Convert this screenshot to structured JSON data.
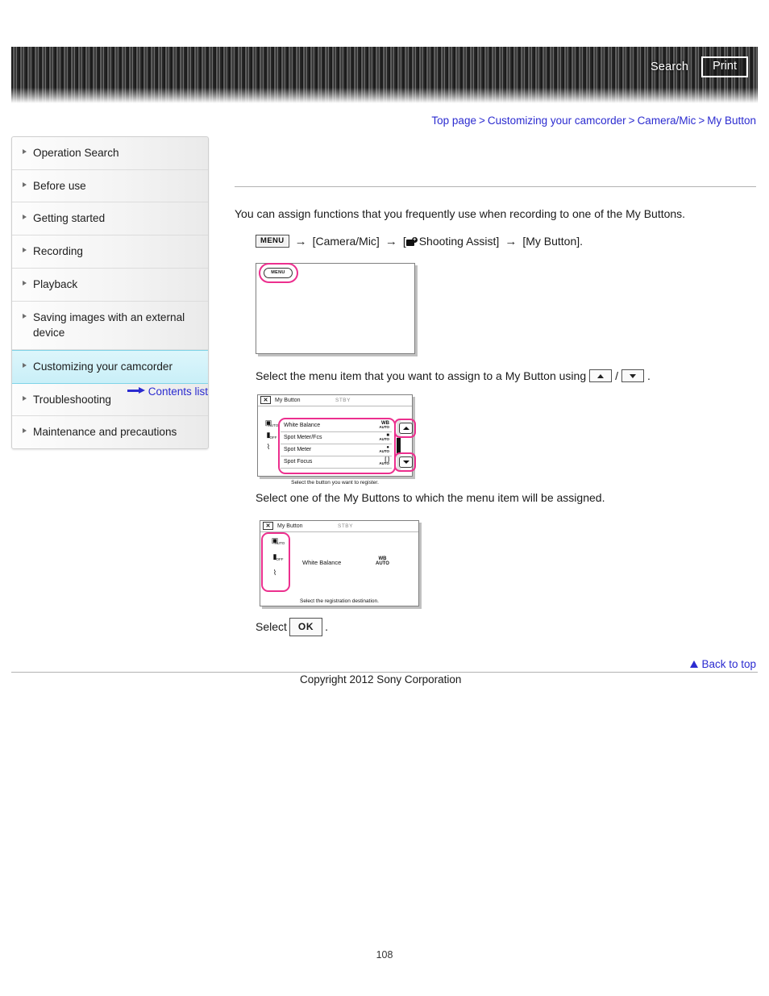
{
  "header": {
    "search_label": "Search",
    "print_label": "Print"
  },
  "breadcrumb": {
    "items": [
      {
        "label": "Top page"
      },
      {
        "label": "Customizing your camcorder"
      },
      {
        "label": "Camera/Mic"
      },
      {
        "label": "My Button"
      }
    ],
    "separator": ">"
  },
  "sidebar": {
    "items": [
      {
        "label": "Operation Search",
        "active": false
      },
      {
        "label": "Before use",
        "active": false
      },
      {
        "label": "Getting started",
        "active": false
      },
      {
        "label": "Recording",
        "active": false
      },
      {
        "label": "Playback",
        "active": false
      },
      {
        "label": "Saving images with an external device",
        "active": false
      },
      {
        "label": "Customizing your camcorder",
        "active": true
      },
      {
        "label": "Troubleshooting",
        "active": false
      },
      {
        "label": "Maintenance and precautions",
        "active": false
      }
    ],
    "contents_link": "Contents list"
  },
  "main": {
    "intro": "You can assign functions that you frequently use when recording to one of the My Buttons.",
    "menu_path": {
      "menu_chip": "MENU",
      "arrow": "→",
      "step1": "[Camera/Mic]",
      "step2_prefix": "[",
      "step2": "Shooting Assist]",
      "step3": "[My Button]."
    },
    "step_a_text": "Select the menu item that you want to assign to a My Button using",
    "step_a_suffix": ".",
    "step_a_divider": "/",
    "step_b_text": "Select one of the My Buttons to which the menu item will be assigned.",
    "step_c_prefix": "Select",
    "step_c_button": "OK",
    "step_c_suffix": "."
  },
  "lcd1": {
    "menu_button": "MENU"
  },
  "lcd2": {
    "title": "My Button",
    "close": "✕",
    "status": "STBY",
    "rows": [
      {
        "label": "White Balance",
        "value": "WB",
        "sub": "AUTO"
      },
      {
        "label": "Spot Meter/Fcs",
        "value": "■",
        "sub": "AUTO"
      },
      {
        "label": "Spot Meter",
        "value": "●",
        "sub": "AUTO"
      },
      {
        "label": "Spot Focus",
        "value": "[ ]",
        "sub": "AUTO"
      }
    ],
    "side_icons": [
      {
        "icon": "▣",
        "sub": "AUTO"
      },
      {
        "icon": "▮",
        "sub": "OFF"
      },
      {
        "icon": "⌇",
        "sub": ""
      }
    ],
    "caption": "Select the button you want to register.",
    "scroll_up": "up-arrow",
    "scroll_down": "down-arrow"
  },
  "lcd3": {
    "title": "My Button",
    "close": "✕",
    "status": "STBY",
    "side_icons": [
      {
        "icon": "▣",
        "sub": "AUTO"
      },
      {
        "icon": "▮",
        "sub": "OFF"
      },
      {
        "icon": "⌇",
        "sub": ""
      }
    ],
    "assigned_label": "White Balance",
    "assigned_value": "WB",
    "assigned_sub": "AUTO",
    "caption": "Select the registration destination."
  },
  "footer": {
    "back_to_top": "Back to top",
    "copyright": "Copyright 2012 Sony Corporation",
    "page_number": "108"
  },
  "colors": {
    "link": "#2b2bd0",
    "highlight": "#c9eff8",
    "pink": "#ec2f8e"
  }
}
